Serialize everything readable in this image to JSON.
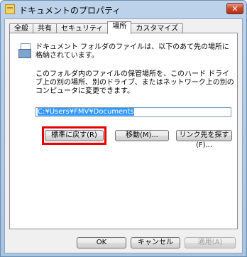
{
  "window": {
    "title": "ドキュメントのプロパティ",
    "close_label": "✕"
  },
  "tabs": [
    {
      "label": "全般"
    },
    {
      "label": "共有"
    },
    {
      "label": "セキュリティ"
    },
    {
      "label": "場所"
    },
    {
      "label": "カスタマイズ"
    }
  ],
  "location_tab": {
    "description_1": "ドキュメント フォルダのファイルは、以下のあて先の場所に格納されています。",
    "description_2": "このフォルダ内のファイルの保管場所を、このハード ドライブ上の別の場所、別のドライブ、またはネットワーク上の別のコンピュータに変更できます。",
    "path_value": "C:¥Users¥FMV¥Documents",
    "restore_default_label": "標準に戻す(R)",
    "move_label": "移動(M)...",
    "find_target_label": "リンク先を探す(F)..."
  },
  "footer": {
    "ok_label": "OK",
    "cancel_label": "キャンセル",
    "apply_label": "適用(A)"
  },
  "colors": {
    "highlight": "#e60000",
    "selection": "#3399ff"
  }
}
